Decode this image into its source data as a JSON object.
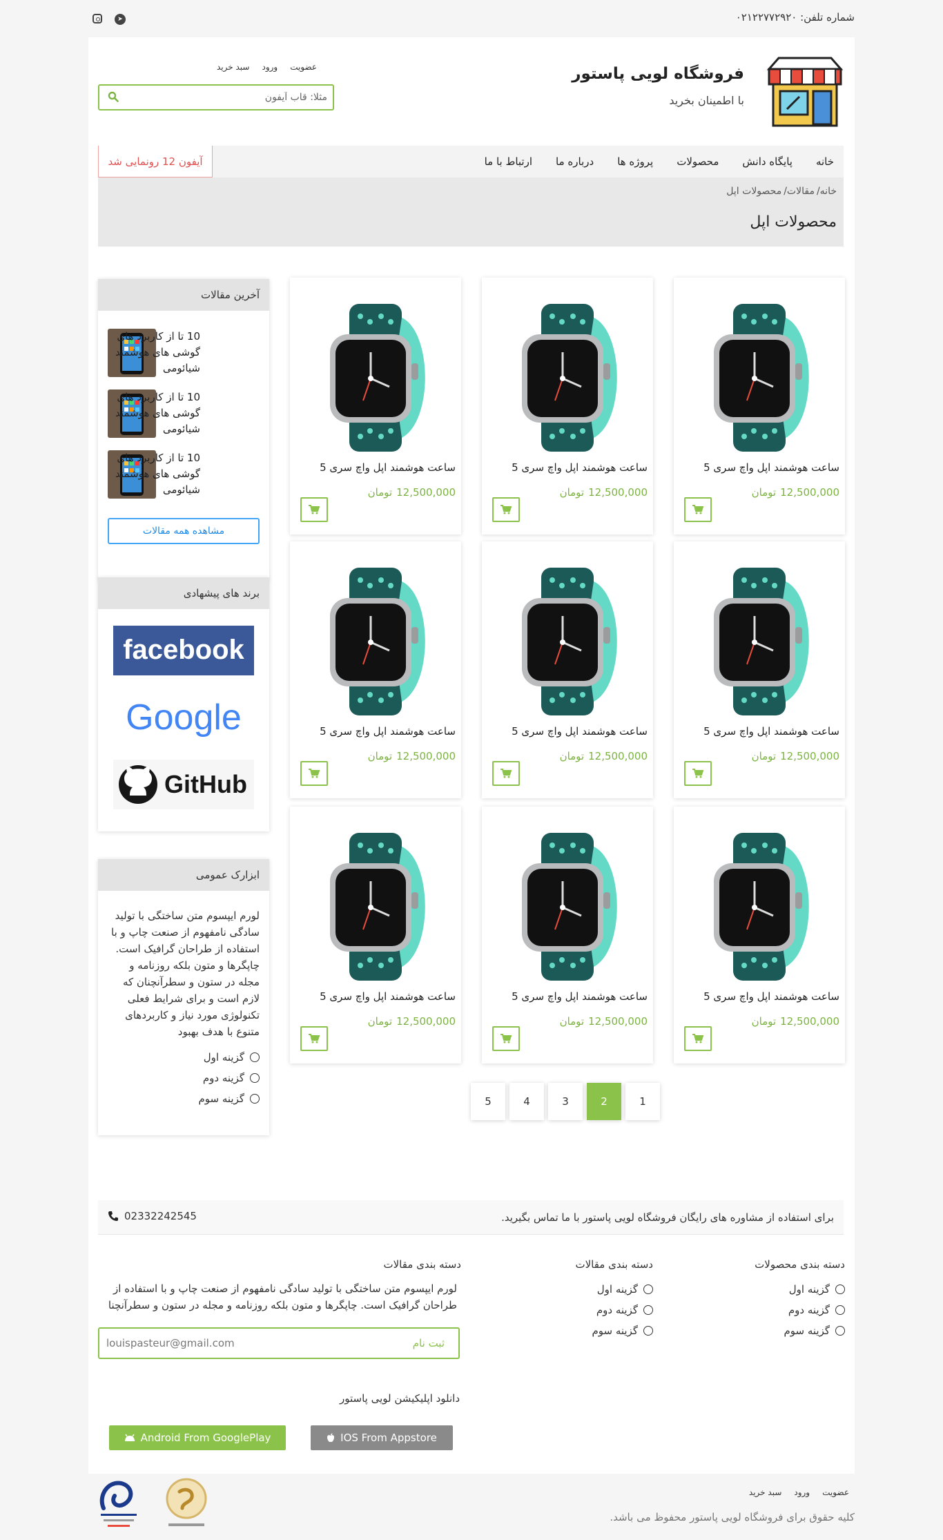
{
  "topbar": {
    "phone": "شماره تلفن: ۰۲۱۲۲۷۷۲۹۲۰"
  },
  "header": {
    "site_title": "فروشگاه لویی پاستور",
    "slogan": "با اطمینان بخرید",
    "user_links": [
      "عضویت",
      "ورود",
      "سبد خرید"
    ],
    "search_placeholder": "مثلا: قاب آیفون"
  },
  "nav": {
    "items": [
      "خانه",
      "پایگاه دانش",
      "محصولات",
      "پروژه ها",
      "درباره ما",
      "ارتباط با ما"
    ],
    "promo": "آیفون 12 رونمایی شد"
  },
  "page_head": {
    "breadcrumb": [
      "خانه/",
      "مقالات/",
      "محصولات اپل"
    ],
    "title": "محصولات اپل"
  },
  "products": [
    {
      "name": "ساعت هوشمند اپل واچ سری 5",
      "price": "12,500,000",
      "currency": "تومان"
    },
    {
      "name": "ساعت هوشمند اپل واچ سری 5",
      "price": "12,500,000",
      "currency": "تومان"
    },
    {
      "name": "ساعت هوشمند اپل واچ سری 5",
      "price": "12,500,000",
      "currency": "تومان"
    },
    {
      "name": "ساعت هوشمند اپل واچ سری 5",
      "price": "12,500,000",
      "currency": "تومان"
    },
    {
      "name": "ساعت هوشمند اپل واچ سری 5",
      "price": "12,500,000",
      "currency": "تومان"
    },
    {
      "name": "ساعت هوشمند اپل واچ سری 5",
      "price": "12,500,000",
      "currency": "تومان"
    },
    {
      "name": "ساعت هوشمند اپل واچ سری 5",
      "price": "12,500,000",
      "currency": "تومان"
    },
    {
      "name": "ساعت هوشمند اپل واچ سری 5",
      "price": "12,500,000",
      "currency": "تومان"
    },
    {
      "name": "ساعت هوشمند اپل واچ سری 5",
      "price": "12,500,000",
      "currency": "تومان"
    }
  ],
  "sidebar": {
    "latest_articles": {
      "title": "آخرین مقالات",
      "items": [
        "10 تا از کاربرد های گوشی های هوشمند شیائومی",
        "10 تا از کاربرد های گوشی های هوشمند شیائومی",
        "10 تا از کاربرد های گوشی های هوشمند شیائومی"
      ],
      "all_button": "مشاهده همه مقالات"
    },
    "brands": {
      "title": "برند های پیشهادی",
      "items": [
        "facebook",
        "Google",
        "GitHub"
      ]
    },
    "general": {
      "title": "ابزارک عمومی",
      "text": "لورم ایپسوم متن ساختگی با تولید سادگی نامفهوم از صنعت چاپ و با استفاده از طراحان گرافیک است. چاپگرها و متون بلکه روزنامه و مجله در ستون و سطرآنچنان که لازم است و برای شرایط فعلی تکنولوژی مورد نیاز و کاربردهای متنوع با هدف بهبود",
      "options": [
        "گزینه اول",
        "گزینه دوم",
        "گزینه سوم"
      ]
    }
  },
  "pagination": [
    "1",
    "2",
    "3",
    "4",
    "5"
  ],
  "pagination_active": "2",
  "footer": {
    "contact_text": "برای استفاده از مشاوره های رایگان فروشگاه لویی پاستور با ما تماس بگیرید.",
    "contact_phone": "02332242545",
    "product_categories": {
      "title": "دسته بندی محصولات",
      "options": [
        "گزینه اول",
        "گزینه دوم",
        "گزینه سوم"
      ]
    },
    "article_categories": {
      "title": "دسته بندی مقالات",
      "options": [
        "گزینه اول",
        "گزینه دوم",
        "گزینه سوم"
      ]
    },
    "article_categories_2": {
      "title": "دسته بندی مقالات"
    },
    "description": "لورم ایپسوم متن ساختگی با تولید سادگی نامفهوم از صنعت چاپ و با استفاده از طراحان گرافیک است. چاپگرها و متون بلکه روزنامه و مجله در ستون و سطرآنچنا",
    "newsletter_email": "louispasteur@gmail.com",
    "newsletter_submit": "ثبت نام",
    "app_title": "دانلود اپلیکیشن لویی پاستور",
    "android_button": "Android From GooglePlay",
    "ios_button": "IOS From Appstore",
    "bottom_links": [
      "عضویت",
      "ورود",
      "سبد خرید"
    ],
    "copyright": "کلیه حقوق برای فروشگاه لویی پاستور محفوظ می باشد."
  },
  "colors": {
    "accent": "#8bc34a",
    "promo": "#e05050",
    "link": "#1e88e5"
  }
}
